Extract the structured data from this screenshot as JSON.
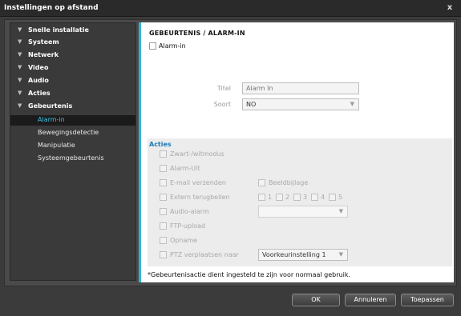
{
  "window": {
    "title": "Instellingen op afstand",
    "close_glyph": "x"
  },
  "sidebar": {
    "items": [
      {
        "label": "Snelle installatie"
      },
      {
        "label": "Systeem"
      },
      {
        "label": "Netwerk"
      },
      {
        "label": "Video"
      },
      {
        "label": "Audio"
      },
      {
        "label": "Acties"
      },
      {
        "label": "Gebeurtenis"
      }
    ],
    "subitems": [
      {
        "label": "Alarm-in",
        "active": true
      },
      {
        "label": "Bewegingsdetectie"
      },
      {
        "label": "Manipulatie"
      },
      {
        "label": "Systeemgebeurtenis"
      }
    ]
  },
  "panel": {
    "heading": "GEBEURTENIS / ALARM-IN",
    "alarm_in_label": "Alarm-in",
    "title_label": "Titel",
    "title_value": "Alarm In",
    "type_label": "Soort",
    "type_value": "NO",
    "actions": {
      "heading": "Acties",
      "bw_mode": "Zwart-/witmodus",
      "alarm_out": "Alarm-Uit",
      "email_send": "E-mail verzenden",
      "image_attach": "Beeldbijlage",
      "callback": "Extern terugbellen",
      "callback_numbers": [
        "1",
        "2",
        "3",
        "4",
        "5"
      ],
      "audio_alarm": "Audio-alarm",
      "ftp_upload": "FTP-upload",
      "recording": "Opname",
      "ptz_move": "PTZ verplaatsen naar",
      "ptz_preset": "Voorkeurinstelling 1"
    },
    "footnote": "*Gebeurtenisactie dient ingesteld te zijn voor normaal gebruik."
  },
  "buttons": {
    "ok": "OK",
    "cancel": "Annuleren",
    "apply": "Toepassen"
  },
  "colors": {
    "accent": "#32b4d6",
    "active_text": "#3ec2e6",
    "actions_title": "#1c7ab4"
  }
}
